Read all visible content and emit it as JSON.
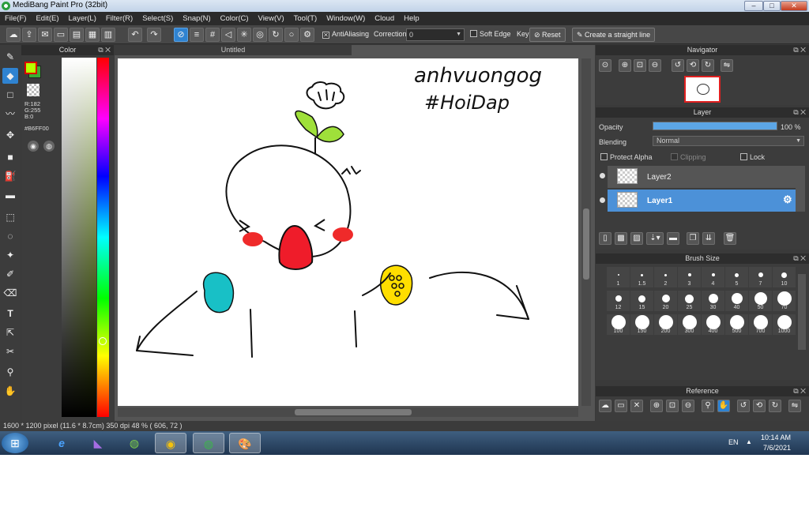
{
  "window": {
    "title": "MediBang Paint Pro (32bit)",
    "controls": [
      "minimize",
      "maximize",
      "close"
    ]
  },
  "menu": [
    "File(F)",
    "Edit(E)",
    "Layer(L)",
    "Filter(R)",
    "Select(S)",
    "Snap(N)",
    "Color(C)",
    "View(V)",
    "Tool(T)",
    "Window(W)",
    "Cloud",
    "Help"
  ],
  "toolbar": {
    "antialiasing": "AntiAliasing",
    "correction_label": "Correction",
    "correction_value": "0",
    "soft_edge": "Soft Edge",
    "key": "Key",
    "reset": "Reset",
    "straight_line": "Create a straight line"
  },
  "color_panel": {
    "title": "Color",
    "r": "R:182",
    "g": "G:255",
    "b": "B:0",
    "hex": "#B6FF00",
    "primary": "#B6FF00",
    "secondary": "#3BAF33"
  },
  "document": {
    "tab": "Untitled"
  },
  "artwork": {
    "line1": "anhvuongog",
    "line2": "#HoiDap"
  },
  "navigator": {
    "title": "Navigator"
  },
  "layer_panel": {
    "title": "Layer",
    "opacity_label": "Opacity",
    "opacity_value": "100 %",
    "opacity_fraction": 1.0,
    "blending_label": "Blending",
    "blending_value": "Normal",
    "protect_alpha": "Protect Alpha",
    "clipping": "Clipping",
    "lock": "Lock",
    "layers": [
      {
        "name": "Layer2"
      },
      {
        "name": "Layer1"
      }
    ]
  },
  "brush_size": {
    "title": "Brush Size",
    "sizes": [
      "1",
      "1.5",
      "2",
      "3",
      "4",
      "5",
      "7",
      "10",
      "12",
      "15",
      "20",
      "25",
      "30",
      "40",
      "50",
      "70",
      "100",
      "150",
      "200",
      "300",
      "400",
      "500",
      "700",
      "1000"
    ]
  },
  "reference": {
    "title": "Reference"
  },
  "status": {
    "text": "1600 * 1200 pixel   (11.6 * 8.7cm)   350 dpi   48 %   ( 606, 72 )"
  },
  "taskbar": {
    "lang": "EN",
    "time": "10:14 AM",
    "date": "7/6/2021"
  }
}
